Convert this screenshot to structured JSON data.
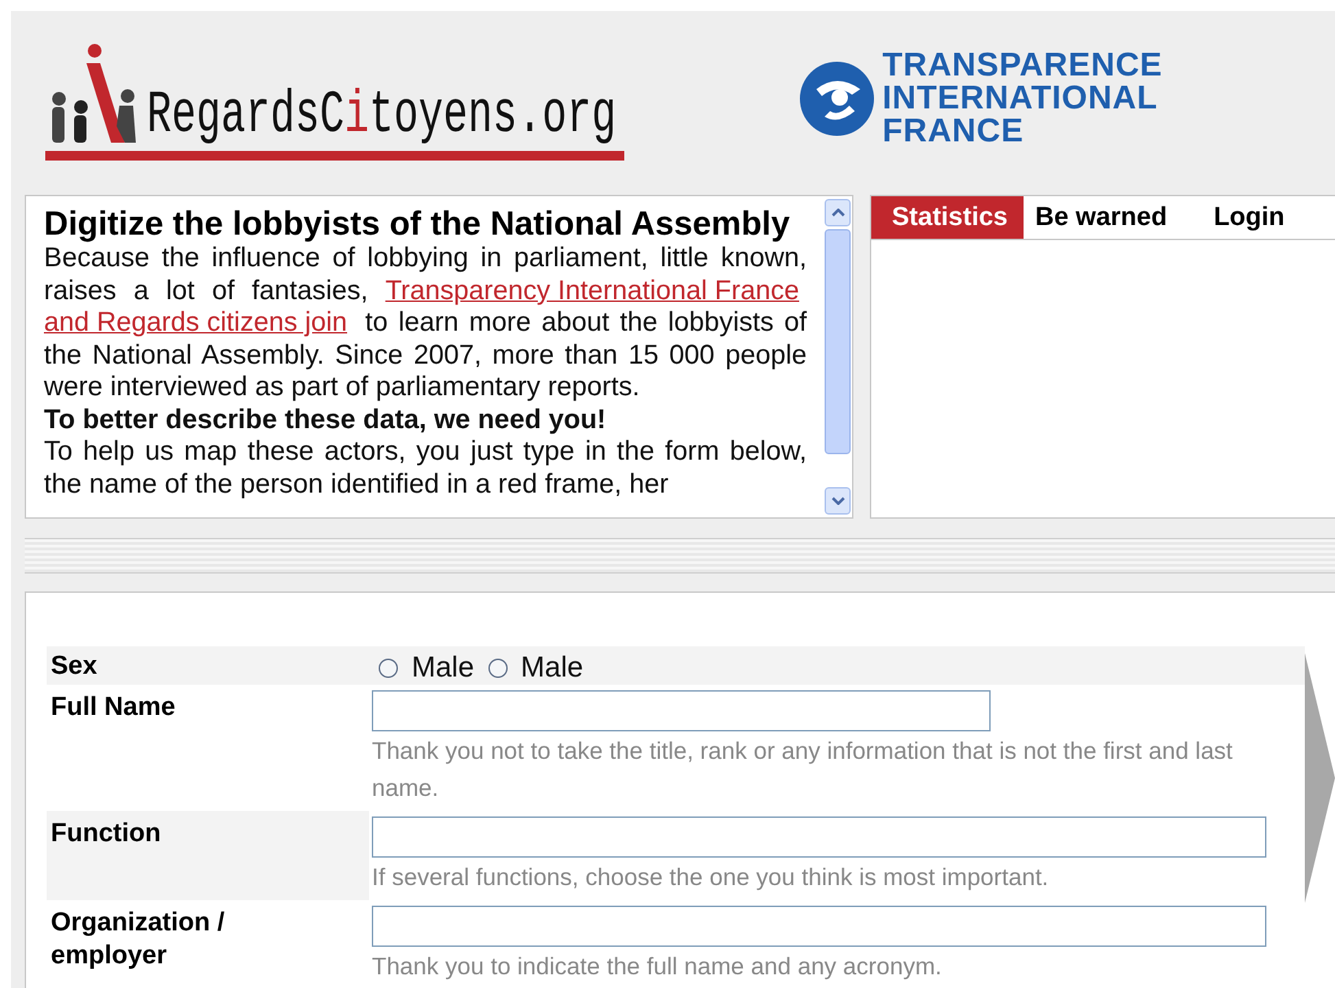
{
  "header": {
    "site_logo": [
      {
        "text": "RegardsC",
        "accent": false
      },
      {
        "text": "i",
        "accent": true
      },
      {
        "text": "toyens.org",
        "accent": false
      }
    ],
    "partner_logo": [
      "TRANSPARENCE",
      "INTERNATIONAL",
      "FRANCE"
    ]
  },
  "intro": {
    "title": "Digitize the lobbyists of the National Assembly",
    "paragraphs": [
      {
        "kind": "text",
        "parts": [
          {
            "kind": "text",
            "text": "Because the influence of lobbying in parliament, little known, raises a lot of fantasies, "
          },
          {
            "kind": "link",
            "text": "Transparency International France"
          },
          {
            "kind": "link",
            "text": "and Regards citizens join"
          },
          {
            "kind": "text",
            "text": " to learn more about the lobbyists of the National Assembly.  Since 2007, more than 15 000 people were interviewed as part of parliamentary reports."
          }
        ]
      },
      {
        "kind": "bold",
        "parts": [
          {
            "kind": "text",
            "text": "To better describe these data, we need you!"
          }
        ]
      },
      {
        "kind": "text",
        "parts": [
          {
            "kind": "text",
            "text": "To help us map these actors, you just type in the form below, the name of the person identified in a red frame, her"
          }
        ]
      }
    ]
  },
  "tabs": [
    {
      "label": "Statistics",
      "selected": true
    },
    {
      "label": "Be warned",
      "selected": false
    },
    {
      "label": "Login",
      "selected": false
    }
  ],
  "form": {
    "rows": [
      {
        "label": "Sex",
        "kind": "radio",
        "options": [
          {
            "label": "Male",
            "selected": false
          },
          {
            "label": "Male",
            "selected": false
          }
        ]
      },
      {
        "label": "Full Name",
        "kind": "text",
        "hint": "Thank you not to take the title, rank or any information that is not the first and last name."
      },
      {
        "label": "Function",
        "kind": "text",
        "hint": "If several functions, choose the one you think is most important."
      },
      {
        "label": "Organization / employer",
        "kind": "text",
        "hint": "Thank you to indicate the full name and any acronym."
      }
    ]
  }
}
